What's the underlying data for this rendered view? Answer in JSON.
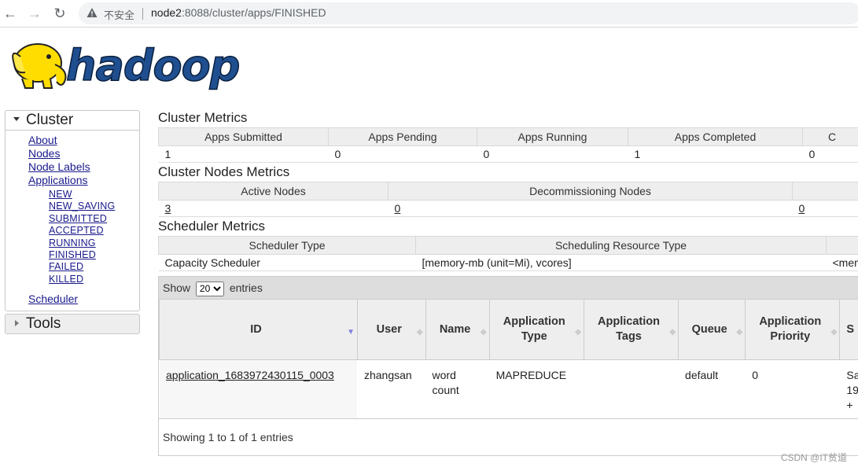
{
  "browser": {
    "security_label": "不安全",
    "url_host": "node2",
    "url_rest": ":8088/cluster/apps/FINISHED"
  },
  "logo": {
    "text": "hadoop",
    "colors": {
      "text": "#1f4f8f",
      "elephant": "#ffdd00"
    }
  },
  "sidebar": {
    "cluster_title": "Cluster",
    "links": [
      "About",
      "Nodes",
      "Node Labels",
      "Applications"
    ],
    "app_states": [
      "NEW",
      "NEW_SAVING",
      "SUBMITTED",
      "ACCEPTED",
      "RUNNING",
      "FINISHED",
      "FAILED",
      "KILLED"
    ],
    "scheduler": "Scheduler",
    "tools_title": "Tools"
  },
  "cluster_metrics": {
    "title": "Cluster Metrics",
    "headers": [
      "Apps Submitted",
      "Apps Pending",
      "Apps Running",
      "Apps Completed",
      "C"
    ],
    "values": [
      "1",
      "0",
      "0",
      "1",
      "0"
    ]
  },
  "nodes_metrics": {
    "title": "Cluster Nodes Metrics",
    "headers": [
      "Active Nodes",
      "Decommissioning Nodes",
      ""
    ],
    "values": [
      "3",
      "0",
      "0"
    ]
  },
  "scheduler_metrics": {
    "title": "Scheduler Metrics",
    "headers": [
      "Scheduler Type",
      "Scheduling Resource Type",
      ""
    ],
    "values": [
      "Capacity Scheduler",
      "[memory-mb (unit=Mi), vcores]",
      "<mem"
    ]
  },
  "apps_table": {
    "show_label": "Show",
    "page_size": "20",
    "entries_label": "entries",
    "columns": [
      "ID",
      "User",
      "Name",
      "Application Type",
      "Application Tags",
      "Queue",
      "Application Priority",
      "S"
    ],
    "rows": [
      {
        "id": "application_1683972430115_0003",
        "user": "zhangsan",
        "name": "word count",
        "type": "MAPREDUCE",
        "tags": "",
        "queue": "default",
        "priority": "0",
        "start": "Sa 19 +"
      }
    ],
    "info": "Showing 1 to 1 of 1 entries"
  },
  "watermark": "CSDN @IT贫道"
}
